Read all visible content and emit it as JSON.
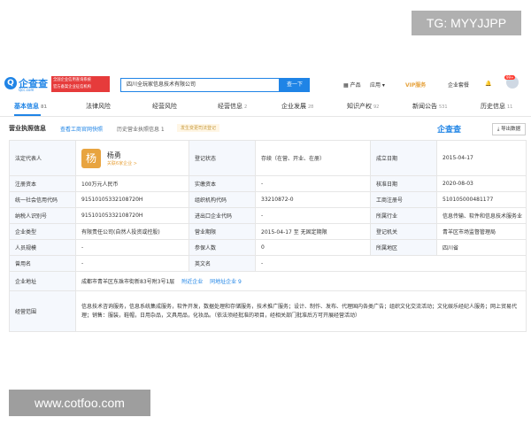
{
  "watermarks": {
    "top": "TG: MYYJJPP",
    "bottom": "www.cotfoo.com"
  },
  "header": {
    "logo_text": "企查查",
    "logo_sub": "Qcc.com",
    "tag_line1": "全国企业信用查询系统",
    "tag_line2": "官方备案企业征信机构",
    "search_value": "四川全玩家信息技术有限公司",
    "search_button": "查一下",
    "nav": [
      "产品",
      "应用",
      "VIP服务",
      "企业套餐"
    ],
    "badge": "99+"
  },
  "tabs": [
    {
      "label": "基本信息",
      "count": "81"
    },
    {
      "label": "法律风险",
      "count": ""
    },
    {
      "label": "经营风险",
      "count": ""
    },
    {
      "label": "经营信息",
      "count": "2"
    },
    {
      "label": "企业发展",
      "count": "28"
    },
    {
      "label": "知识产权",
      "count": "92"
    },
    {
      "label": "新闻公告",
      "count": "531"
    },
    {
      "label": "历史信息",
      "count": "11"
    }
  ],
  "section": {
    "title": "营业执照信息",
    "link": "查看工商官网快照",
    "history": "历史营业执照信息 1",
    "tip": "发生变更司法登记",
    "brand": "企查查",
    "export": "导出数据"
  },
  "table": {
    "legal_rep_label": "法定代表人",
    "legal_rep_avatar": "杨",
    "legal_rep_name": "杨勇",
    "legal_rep_rel": "关联6家企业 >",
    "reg_status_label": "登记状态",
    "reg_status": "存续（在营、开业、在册）",
    "founded_label": "成立日期",
    "founded": "2015-04-17",
    "reg_capital_label": "注册资本",
    "reg_capital": "100万元人民币",
    "paid_capital_label": "实缴资本",
    "paid_capital": "-",
    "approval_label": "核准日期",
    "approval": "2020-08-03",
    "credit_code_label": "统一社会信用代码",
    "credit_code": "91510105332108720H",
    "org_code_label": "组织机构代码",
    "org_code": "33210872-0",
    "biz_reg_no_label": "工商注册号",
    "biz_reg_no": "510105000481177",
    "tax_id_label": "纳税人识别号",
    "tax_id": "91510105332108720H",
    "import_export_label": "进出口企业代码",
    "import_export": "-",
    "industry_label": "所属行业",
    "industry": "信息传输、软件和信息技术服务业",
    "type_label": "企业类型",
    "type": "有限责任公司(自然人投资或控股)",
    "term_label": "营业期限",
    "term": "2015-04-17 至 无固定期限",
    "authority_label": "登记机关",
    "authority": "青羊区市场监督管理局",
    "staff_label": "人员规模",
    "staff": "-",
    "insured_label": "参保人数",
    "insured": "0",
    "region_label": "所属地区",
    "region": "四川省",
    "former_name_label": "曾用名",
    "former_name": "-",
    "english_name_label": "英文名",
    "english_name": "-",
    "address_label": "企业地址",
    "address": "成都市青羊区东珠市街新83号附3号1层",
    "address_link1": "附近企业",
    "address_link2": "同地址企业 9",
    "scope_label": "经营范围",
    "scope": "信息技术咨询服务，信息系统集成服务，软件开发，数据处理和存储服务，技术推广服务；设计、制作、发布、代理国内各类广告；组织文化交流活动；文化娱乐经纪人服务；网上贸易代理；销售：服装，鞋帽，日用杂品，文具用品，化妆品。（依法须经批准的项目，经相关部门批准后方可开展经营活动）"
  }
}
